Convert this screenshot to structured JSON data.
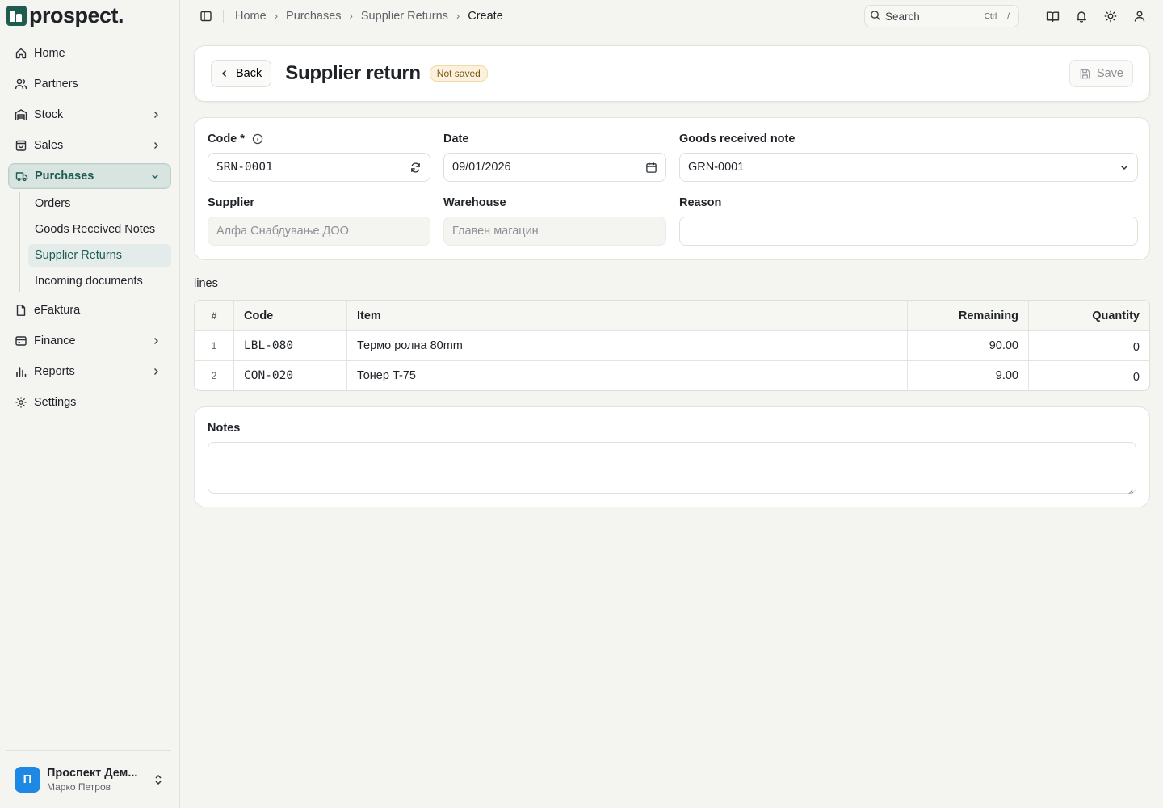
{
  "brand": {
    "name": "prospect."
  },
  "sidebar": {
    "items": [
      {
        "label": "Home",
        "icon": "home-icon"
      },
      {
        "label": "Partners",
        "icon": "users-icon"
      },
      {
        "label": "Stock",
        "icon": "warehouse-icon"
      },
      {
        "label": "Sales",
        "icon": "shopping-bag-icon"
      },
      {
        "label": "Purchases",
        "icon": "truck-icon"
      },
      {
        "label": "eFaktura",
        "icon": "file-icon"
      },
      {
        "label": "Finance",
        "icon": "wallet-icon"
      },
      {
        "label": "Reports",
        "icon": "bar-chart-icon"
      },
      {
        "label": "Settings",
        "icon": "gear-icon"
      }
    ],
    "purchases_sub": [
      {
        "label": "Orders"
      },
      {
        "label": "Goods Received Notes"
      },
      {
        "label": "Supplier Returns"
      },
      {
        "label": "Incoming documents"
      }
    ],
    "org": {
      "initial": "П",
      "name": "Проспект Дем...",
      "user": "Марко Петров"
    }
  },
  "topbar": {
    "breadcrumbs": [
      "Home",
      "Purchases",
      "Supplier Returns",
      "Create"
    ],
    "search": {
      "label": "Search",
      "kbd1": "Ctrl",
      "kbd2": "/"
    }
  },
  "header": {
    "back_label": "Back",
    "title": "Supplier return",
    "status": "Not saved",
    "save_label": "Save"
  },
  "form": {
    "code": {
      "label": "Code *",
      "value": "SRN-0001"
    },
    "date": {
      "label": "Date",
      "value": "09/01/2026"
    },
    "grn": {
      "label": "Goods received note",
      "value": "GRN-0001"
    },
    "supplier": {
      "label": "Supplier",
      "value": "Алфа Снабдување ДОО"
    },
    "warehouse": {
      "label": "Warehouse",
      "value": "Главен магацин"
    },
    "reason": {
      "label": "Reason",
      "value": ""
    }
  },
  "lines": {
    "label": "lines",
    "columns": [
      "#",
      "Code",
      "Item",
      "Remaining",
      "Quantity"
    ],
    "rows": [
      {
        "idx": "1",
        "code": "LBL-080",
        "item": "Термо ролна 80mm",
        "remaining": "90.00",
        "quantity": "0"
      },
      {
        "idx": "2",
        "code": "CON-020",
        "item": "Тонер T-75",
        "remaining": "9.00",
        "quantity": "0"
      }
    ]
  },
  "notes": {
    "label": "Notes",
    "value": ""
  },
  "colors": {
    "accent": "#1f5b4f",
    "badge_bg": "#fbf1dc",
    "org_avatar": "#1e88e5"
  }
}
